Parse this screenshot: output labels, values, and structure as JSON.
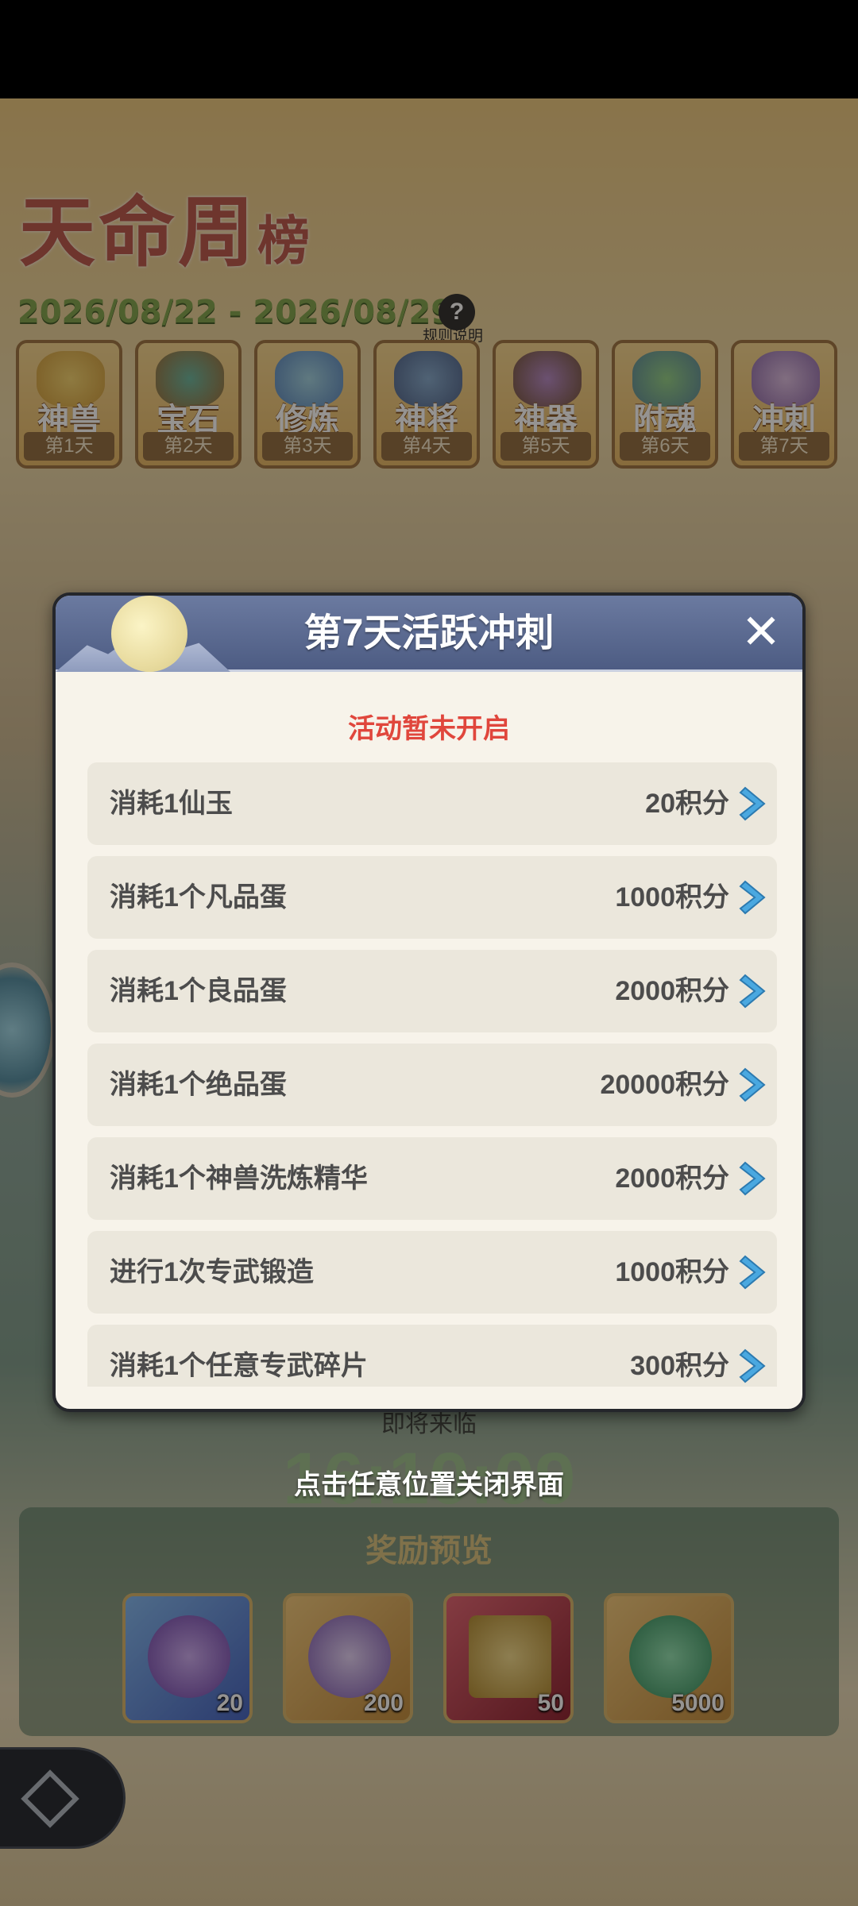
{
  "game": {
    "title_main": "天命周",
    "title_small": "榜",
    "date_range": "2026/08/22 - 2026/08/29",
    "rules_label": "规则说明",
    "tabs": [
      {
        "name": "神兽",
        "day": "第1天"
      },
      {
        "name": "宝石",
        "day": "第2天"
      },
      {
        "name": "修炼",
        "day": "第3天"
      },
      {
        "name": "神将",
        "day": "第4天"
      },
      {
        "name": "神器",
        "day": "第5天"
      },
      {
        "name": "附魂",
        "day": "第6天"
      },
      {
        "name": "冲刺",
        "day": "第7天"
      }
    ],
    "coming_soon": "即将来临",
    "countdown": "16:10:09",
    "close_hint": "点击任意位置关闭界面",
    "reward_title": "奖励预览",
    "rewards": [
      {
        "qty": "20",
        "icon": "purple-gem-icon"
      },
      {
        "qty": "200",
        "icon": "purple-coin-icon"
      },
      {
        "qty": "50",
        "icon": "gold-card-icon"
      },
      {
        "qty": "5000",
        "icon": "jade-dragon-icon"
      }
    ]
  },
  "modal": {
    "title": "第7天活跃冲刺",
    "close_glyph": "✕",
    "status": "活动暂未开启",
    "tasks": [
      {
        "label": "消耗1仙玉",
        "points": "20积分"
      },
      {
        "label": "消耗1个凡品蛋",
        "points": "1000积分"
      },
      {
        "label": "消耗1个良品蛋",
        "points": "2000积分"
      },
      {
        "label": "消耗1个绝品蛋",
        "points": "20000积分"
      },
      {
        "label": "消耗1个神兽洗炼精华",
        "points": "2000积分"
      },
      {
        "label": "进行1次专武锻造",
        "points": "1000积分"
      },
      {
        "label": "消耗1个任意专武碎片",
        "points": "300积分"
      }
    ]
  },
  "colors": {
    "accent_red": "#e0463c",
    "arrow_blue": "#4aa8e0",
    "header_blue": "#5a6a92"
  }
}
